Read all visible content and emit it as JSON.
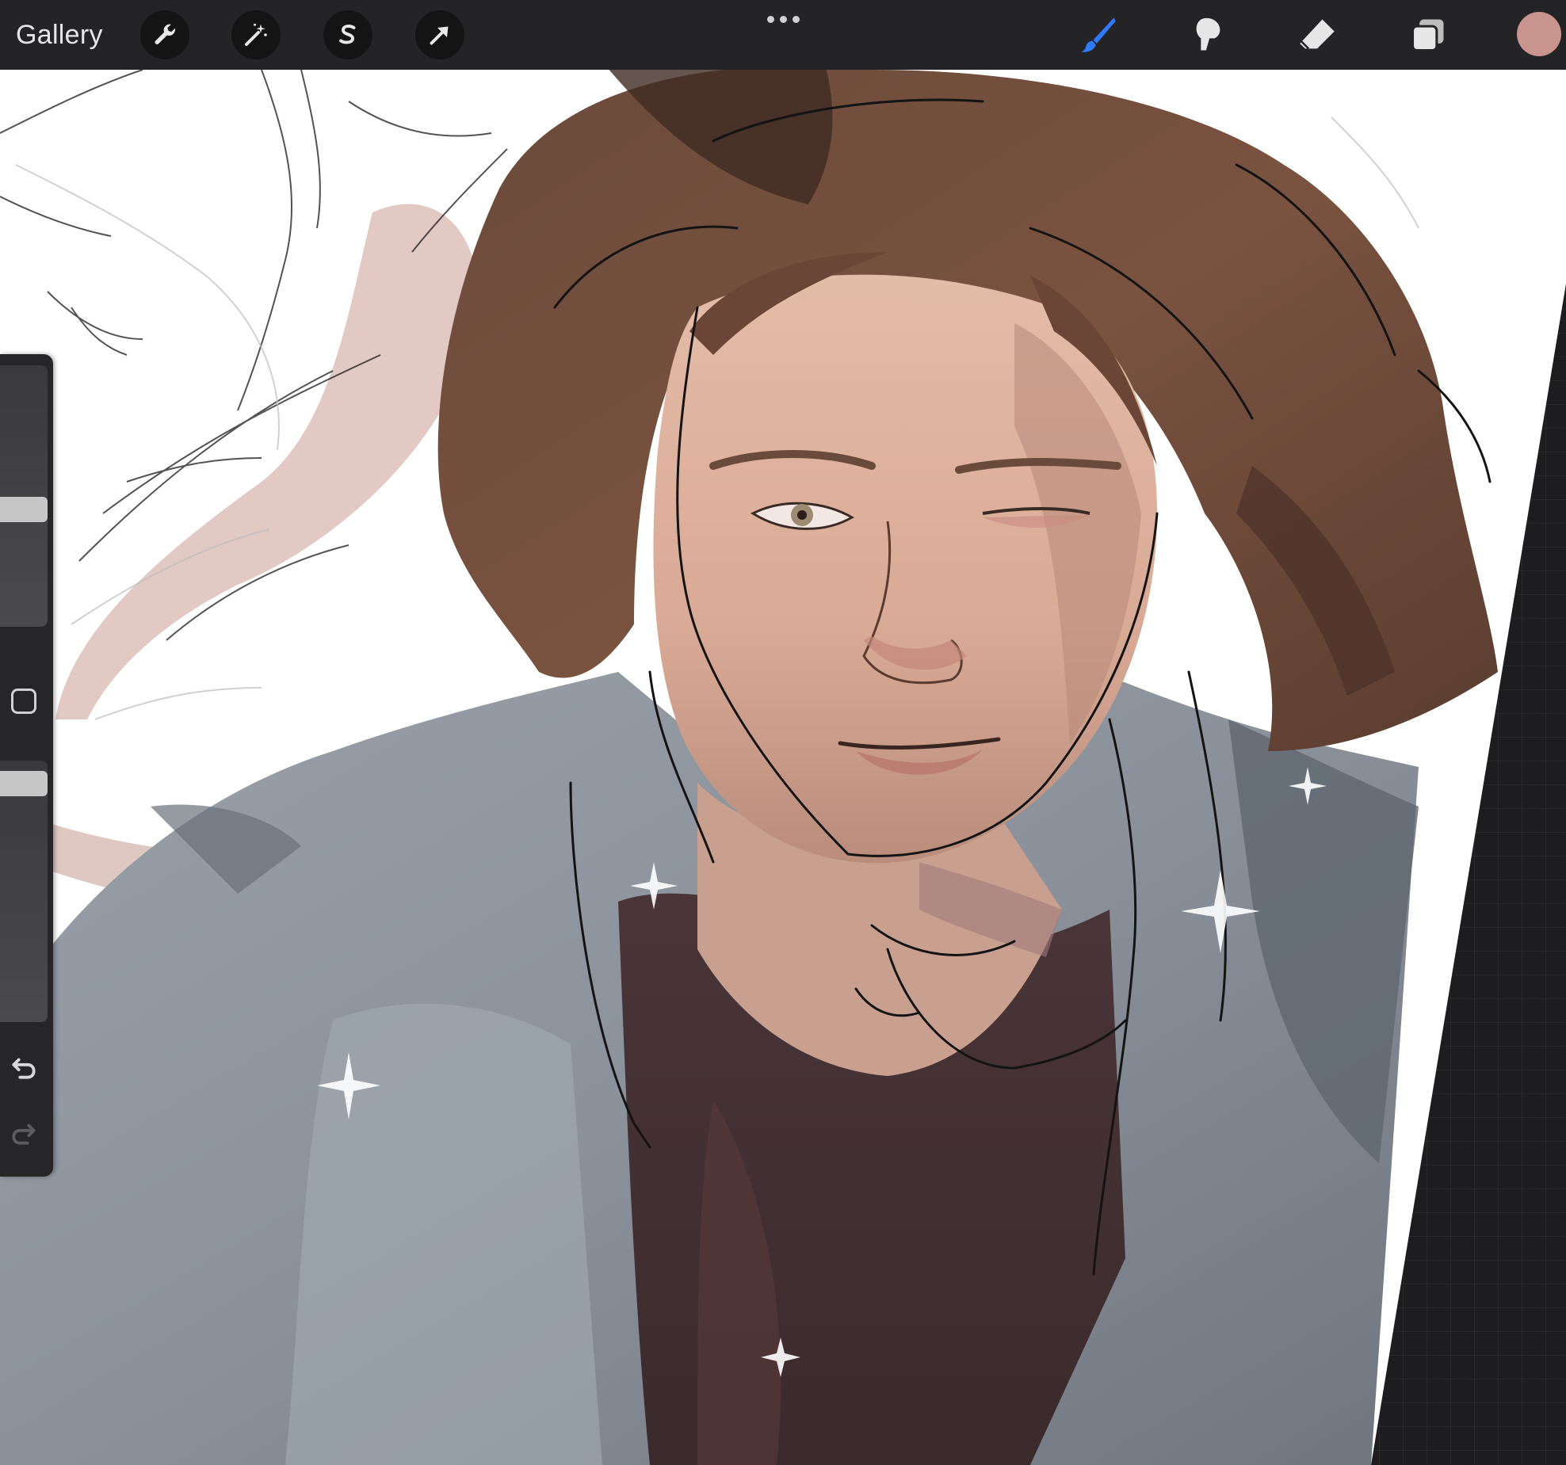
{
  "toolbar": {
    "gallery_label": "Gallery",
    "left_tools": [
      {
        "name": "actions",
        "icon": "wrench-icon"
      },
      {
        "name": "adjustments",
        "icon": "magic-wand-icon"
      },
      {
        "name": "selection",
        "icon": "selection-s-icon"
      },
      {
        "name": "transform",
        "icon": "arrow-cursor-icon"
      }
    ],
    "more_icon": "more-dots-icon",
    "right_tools": [
      {
        "name": "brush",
        "icon": "brush-icon",
        "active": true,
        "color": "#2f7bff"
      },
      {
        "name": "smudge",
        "icon": "smudge-icon",
        "active": false
      },
      {
        "name": "eraser",
        "icon": "eraser-icon",
        "active": false
      },
      {
        "name": "layers",
        "icon": "layers-icon",
        "active": false
      }
    ],
    "current_color": "#c9948d"
  },
  "sidebar": {
    "brush_size_icon": "slider-icon",
    "modify_icon": "square-icon",
    "undo_icon": "undo-arrow-icon",
    "redo_icon": "redo-arrow-icon"
  },
  "canvas": {
    "description_icon": "artwork"
  }
}
